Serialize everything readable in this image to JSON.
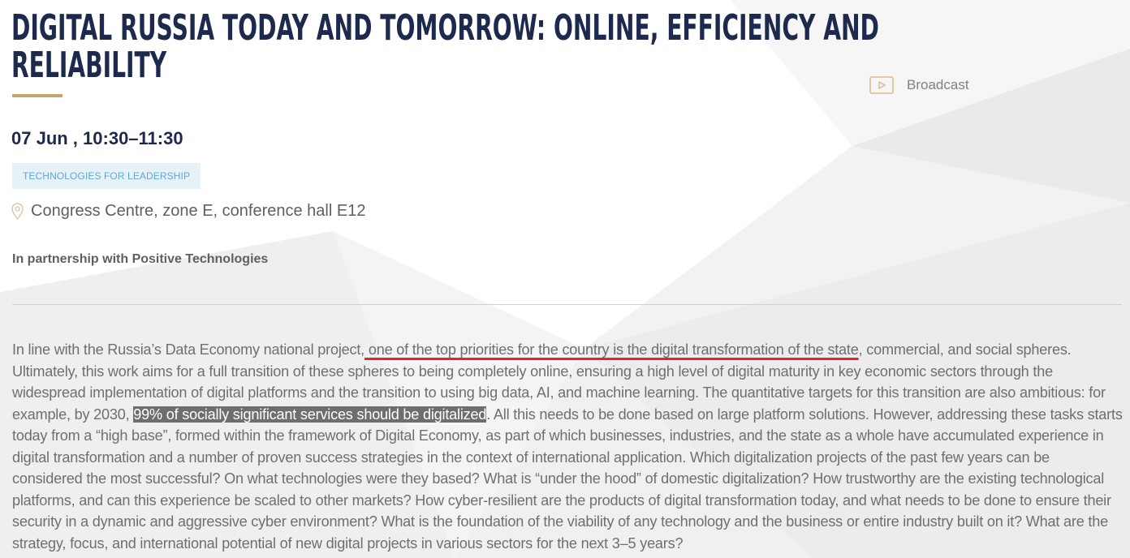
{
  "event": {
    "title_line1": "DIGITAL RUSSIA TODAY AND TOMORROW: ONLINE, EFFICIENCY AND",
    "title_line2": "RELIABILITY",
    "datetime": "07 Jun , 10:30–11:30",
    "track": "TECHNOLOGIES FOR LEADERSHIP",
    "location": "Congress Centre, zone E, conference hall E12",
    "partnership": "In partnership with Positive Technologies",
    "broadcast_label": "Broadcast"
  },
  "description": {
    "part1": "In line with the Russia’s Data Economy national project,",
    "underlined": " one of the top priorities for the country is the digital transformation of the state",
    "part2": ", commercial, and social spheres. Ultimately, this work aims for a full transition of these spheres to being completely online, ensuring a high level of digital maturity in key economic sectors through the widespread implementation of digital platforms and the transition to using big data, AI, and machine learning. The quantitative targets for this transition are also ambitious: for example, by 2030, ",
    "highlighted": "99% of socially significant services should be digitalized",
    "part3": ". All this needs to be done based on large platform solutions. However, addressing these tasks starts today from a “high base”, formed within the framework of Digital Economy, as part of which businesses, industries, and the state as a whole have accumulated experience in digital transformation and a number of proven success strategies in the context of international application. Which digitalization projects of the past few years can be considered the most successful? On what technologies were they based? What is “under the hood” of domestic digitalization? How trustworthy are the existing technological platforms, and can this experience be scaled to other markets? How cyber-resilient are the products of digital transformation today, and what needs to be done to ensure their security in a dynamic and aggressive cyber environment? What is the foundation of the viability of any technology and the business or entire industry built on it? What are the strategy, focus, and international potential of new digital projects in various sectors for the next 3–5 years?"
  },
  "icons": {
    "broadcast": "play-icon",
    "location": "pin-icon"
  },
  "colors": {
    "title": "#1d2a4d",
    "accent_gold": "#c7a46a",
    "badge_background": "#e7f1f8",
    "badge_text": "#5fa8d3",
    "body_text": "#6d6f73",
    "underline_red": "#e3262c",
    "highlight_background": "#6e6e6e"
  }
}
